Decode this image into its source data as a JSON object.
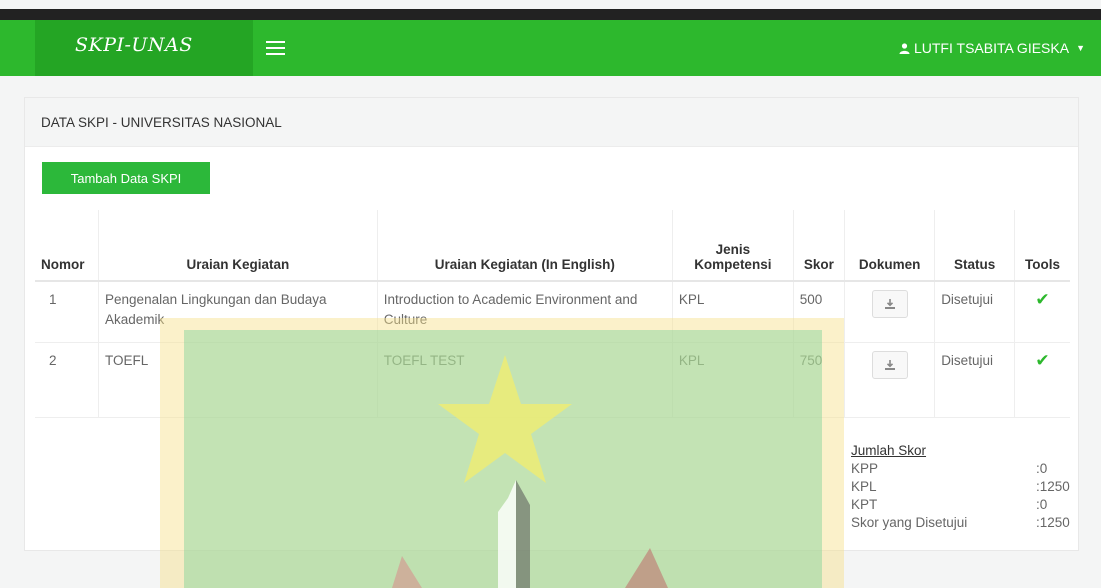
{
  "navbar": {
    "brand": "SKPI-UNAS",
    "user_name": "LUTFI TSABITA GIESKA"
  },
  "icons": {
    "menu": "hamburger-menu-icon",
    "user": "user-icon",
    "caret": "caret-down-icon",
    "download": "download-icon",
    "approve": "check-icon"
  },
  "colors": {
    "navbar": "#2db82d",
    "brand_area": "#24a524",
    "add_button": "#2cb83a",
    "check": "#2db82d"
  },
  "panel": {
    "title": "DATA SKPI - UNIVERSITAS NASIONAL",
    "add_button": "Tambah Data SKPI"
  },
  "table": {
    "headers": {
      "nomor": "Nomor",
      "uraian": "Uraian Kegiatan",
      "uraian_en": "Uraian Kegiatan (In English)",
      "jenis": "Jenis Kompetensi",
      "skor": "Skor",
      "dokumen": "Dokumen",
      "status": "Status",
      "tools": "Tools"
    },
    "rows": [
      {
        "nomor": "1",
        "uraian": "Pengenalan Lingkungan dan Budaya Akademik",
        "uraian_en": "Introduction to Academic Environment and Culture",
        "jenis": "KPL",
        "skor": "500",
        "status": "Disetujui"
      },
      {
        "nomor": "2",
        "uraian": "TOEFL",
        "uraian_en": "TOEFL TEST",
        "jenis": "KPL",
        "skor": "750",
        "status": "Disetujui"
      }
    ]
  },
  "summary": {
    "title": "Jumlah Skor",
    "items": [
      {
        "label": "KPP",
        "value": ":0"
      },
      {
        "label": "KPL",
        "value": ":1250"
      },
      {
        "label": "KPT",
        "value": ":0"
      },
      {
        "label": "Skor yang Disetujui",
        "value": ":1250"
      }
    ]
  }
}
